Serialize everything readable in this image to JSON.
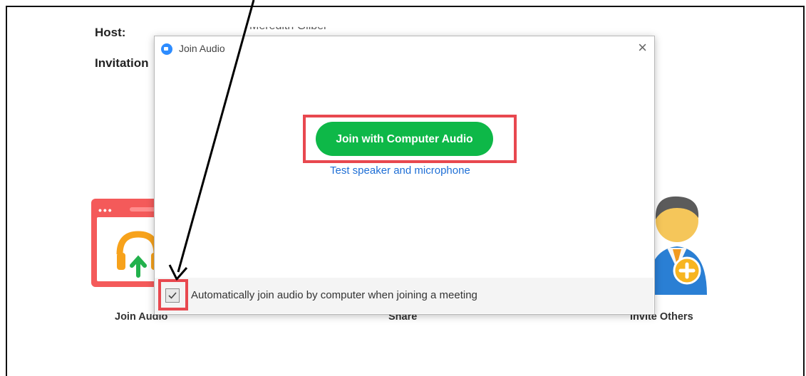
{
  "background": {
    "host_label": "Host:",
    "host_value": "Meredith Gilber",
    "invitation_label": "Invitation",
    "bottom_actions": [
      {
        "label": "Join Audio"
      },
      {
        "label": "Share"
      },
      {
        "label": "Invite Others"
      }
    ]
  },
  "dialog": {
    "title": "Join Audio",
    "close_glyph": "×",
    "join_button_label": "Join with Computer Audio",
    "test_link_label": "Test speaker and microphone",
    "auto_join_label": "Automatically join audio by computer when joining a meeting",
    "auto_join_checked": true
  },
  "colors": {
    "join_button": "#0eb848",
    "highlight": "#e8484f",
    "link": "#1f6fd6",
    "logo": "#2d8cff"
  }
}
